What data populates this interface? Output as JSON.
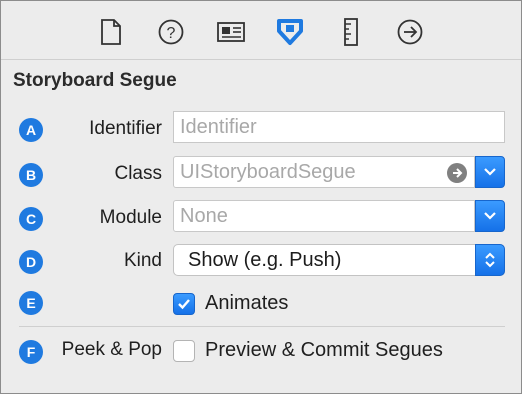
{
  "toolbar": {
    "icons": [
      "file-inspector-icon",
      "quick-help-icon",
      "identity-inspector-icon",
      "attributes-inspector-icon",
      "size-inspector-icon",
      "connections-inspector-icon"
    ]
  },
  "section": {
    "title": "Storyboard Segue"
  },
  "rows": {
    "identifier": {
      "letter": "A",
      "label": "Identifier",
      "placeholder": "Identifier"
    },
    "class": {
      "letter": "B",
      "label": "Class",
      "placeholder": "UIStoryboardSegue"
    },
    "module": {
      "letter": "C",
      "label": "Module",
      "placeholder": "None"
    },
    "kind": {
      "letter": "D",
      "label": "Kind",
      "value": "Show (e.g. Push)"
    },
    "animates": {
      "letter": "E",
      "label": "Animates",
      "checked": true
    },
    "peek": {
      "letter": "F",
      "label": "Peek & Pop",
      "option": "Preview & Commit Segues",
      "checked": false
    }
  },
  "colors": {
    "accent": "#1f7ae0",
    "background": "#ececec"
  }
}
